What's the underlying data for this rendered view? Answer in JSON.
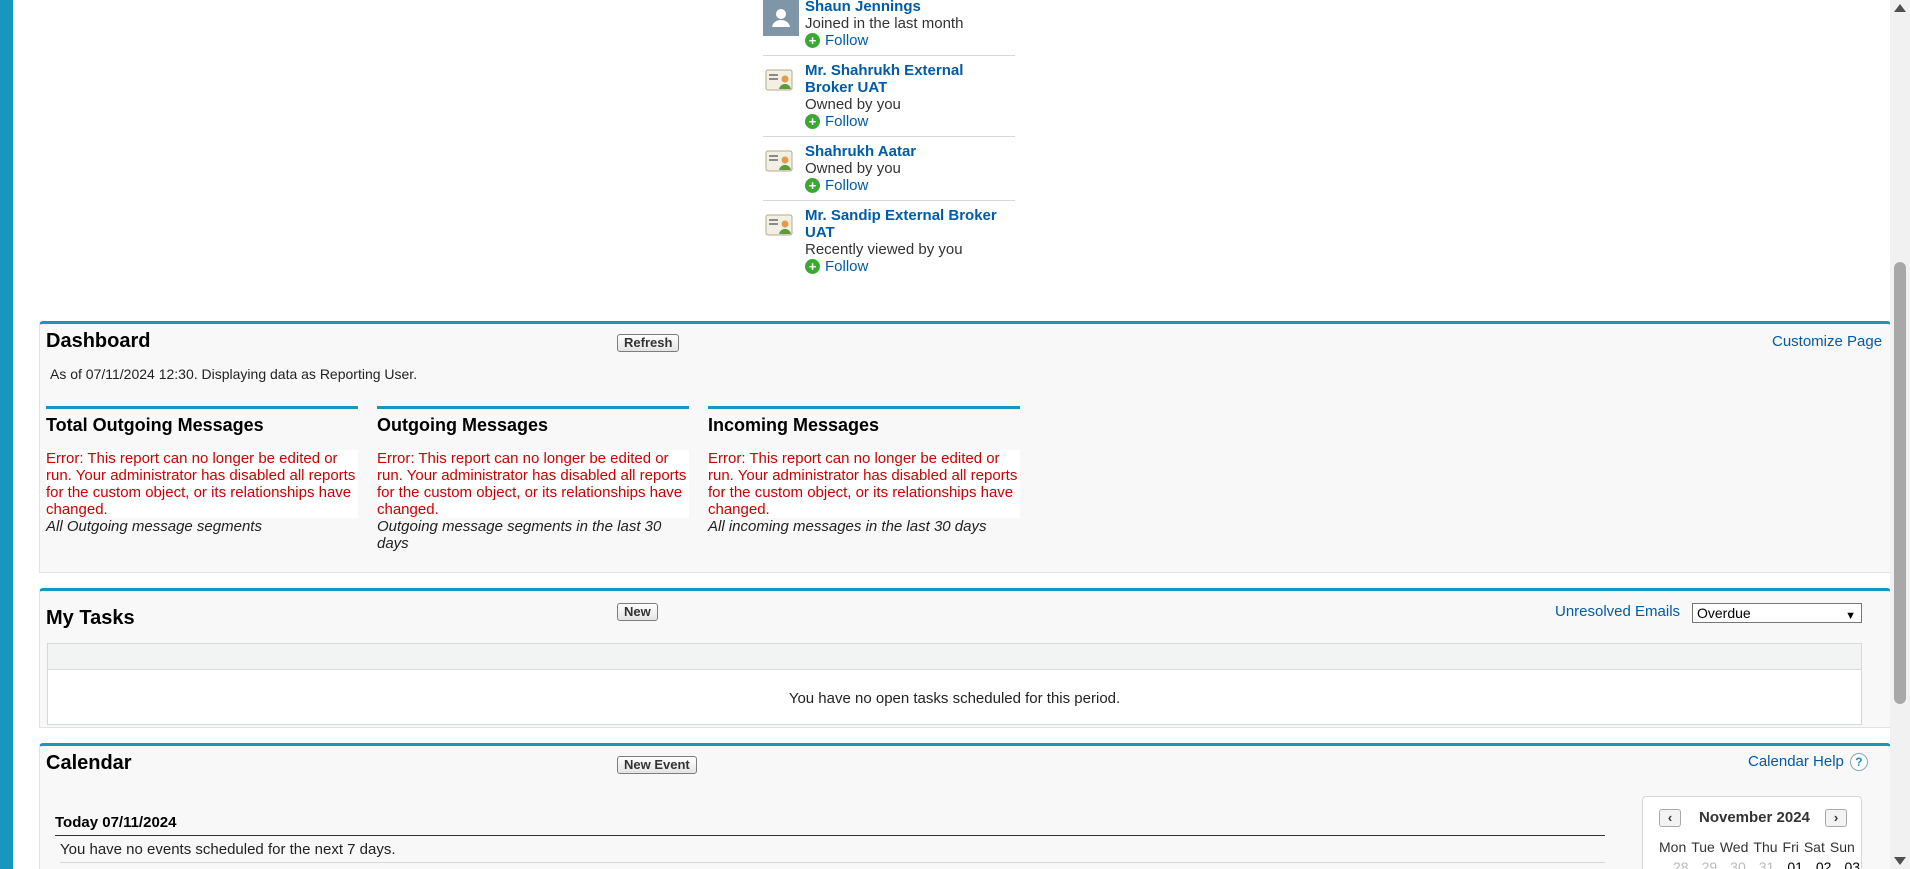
{
  "recommendations": [
    {
      "name": "Shaun Jennings",
      "desc": "Joined in the last month",
      "follow": "Follow",
      "icon": "person-avatar-icon"
    },
    {
      "name": "Mr. Shahrukh External Broker UAT",
      "desc": "Owned by you",
      "follow": "Follow",
      "icon": "contact-card-icon"
    },
    {
      "name": "Shahrukh Aatar",
      "desc": "Owned by you",
      "follow": "Follow",
      "icon": "contact-card-icon"
    },
    {
      "name": "Mr. Sandip External Broker UAT",
      "desc": "Recently viewed by you",
      "follow": "Follow",
      "icon": "contact-card-icon"
    }
  ],
  "dashboard": {
    "title": "Dashboard",
    "refresh_label": "Refresh",
    "customize_label": "Customize Page",
    "subtitle": "As of 07/11/2024 12:30. Displaying data as Reporting User.",
    "components": [
      {
        "title": "Total Outgoing Messages",
        "error": "Error: This report can no longer be edited or run. Your administrator has disabled all reports for the custom object, or its relationships have changed.",
        "footer": "All Outgoing message segments"
      },
      {
        "title": "Outgoing Messages",
        "error": "Error: This report can no longer be edited or run. Your administrator has disabled all reports for the custom object, or its relationships have changed.",
        "footer": "Outgoing message segments in the last 30 days"
      },
      {
        "title": "Incoming Messages",
        "error": "Error: This report can no longer be edited or run. Your administrator has disabled all reports for the custom object, or its relationships have changed.",
        "footer": "All incoming messages in the last 30 days"
      }
    ]
  },
  "tasks": {
    "title": "My Tasks",
    "new_label": "New",
    "unresolved_label": "Unresolved Emails",
    "filter_value": "Overdue",
    "empty_text": "You have no open tasks scheduled for this period."
  },
  "calendar": {
    "title": "Calendar",
    "new_event_label": "New Event",
    "help_label": "Calendar Help",
    "today_label": "Today 07/11/2024",
    "empty_text": "You have no events scheduled for the next 7 days.",
    "mini": {
      "month": "November 2024",
      "day_names": [
        "Mon",
        "Tue",
        "Wed",
        "Thu",
        "Fri",
        "Sat",
        "Sun"
      ],
      "first_row": [
        "28",
        "29",
        "30",
        "31",
        "01",
        "02",
        "03"
      ]
    }
  },
  "colors": {
    "accent": "#1797c0",
    "link": "#015ba7",
    "error": "#cc0000",
    "follow_plus": "#3aa832"
  }
}
